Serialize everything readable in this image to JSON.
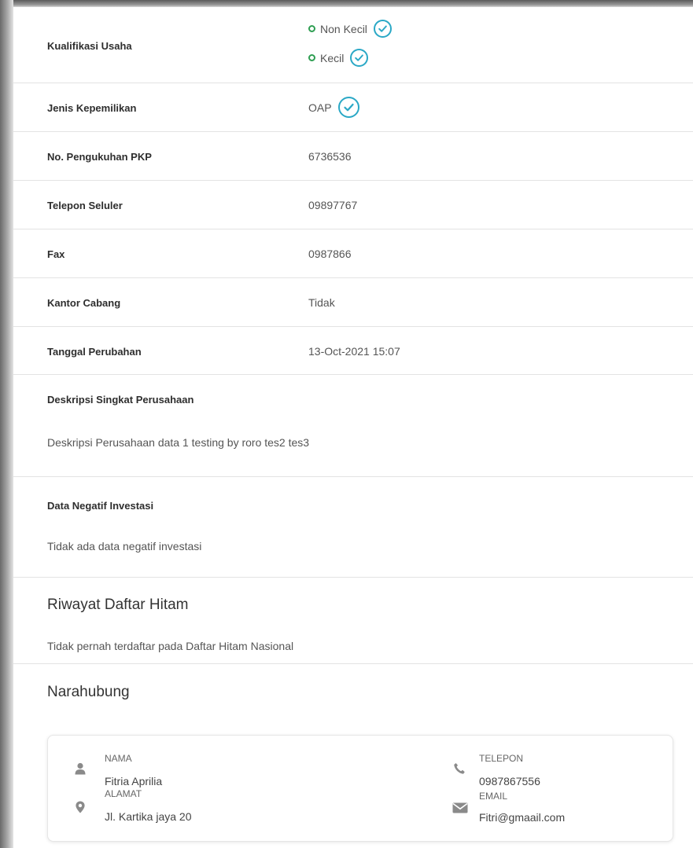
{
  "kualifikasi": {
    "label": "Kualifikasi Usaha",
    "options": [
      "Non Kecil",
      "Kecil"
    ]
  },
  "rows": [
    {
      "label": "Jenis Kepemilikan",
      "value": "OAP"
    },
    {
      "label": "No. Pengukuhan PKP",
      "value": "6736536"
    },
    {
      "label": "Telepon Seluler",
      "value": "09897767"
    },
    {
      "label": "Fax",
      "value": "0987866"
    },
    {
      "label": "Kantor Cabang",
      "value": "Tidak"
    },
    {
      "label": "Tanggal Perubahan",
      "value": "13-Oct-2021 15:07"
    }
  ],
  "deskripsi": {
    "label": "Deskripsi Singkat Perusahaan",
    "text": "Deskripsi Perusahaan data 1 testing by roro tes2 tes3"
  },
  "negatif": {
    "label": "Data Negatif Investasi",
    "text": "Tidak ada data negatif investasi"
  },
  "riwayat": {
    "title": "Riwayat Daftar Hitam",
    "text": "Tidak pernah terdaftar pada Daftar Hitam Nasional"
  },
  "narahubung": {
    "title": "Narahubung",
    "nama_label": "NAMA",
    "nama": "Fitria Aprilia",
    "alamat_label": "ALAMAT",
    "alamat": "Jl. Kartika jaya 20",
    "telepon_label": "TELEPON",
    "telepon": "0987867556",
    "email_label": "EMAIL",
    "email": "Fitri@gmaail.com"
  },
  "colors": {
    "radio_ring": "#2e9e52",
    "check_accent": "#2aa8c6",
    "icon_gray": "#8a8a8a"
  }
}
